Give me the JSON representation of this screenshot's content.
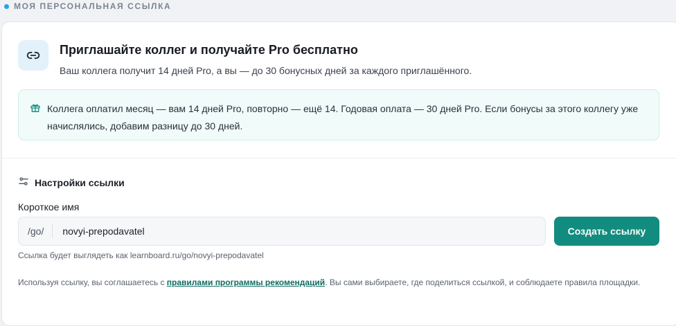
{
  "section": {
    "title": "МОЯ ПЕРСОНАЛЬНАЯ ССЫЛКА"
  },
  "hero": {
    "icon": "link-icon",
    "title": "Приглашайте коллег и получайте Pro бесплатно",
    "subtitle": "Ваш коллега получит 14 дней Pro, а вы — до 30 бонусных дней за каждого приглашённого."
  },
  "notice": {
    "icon": "gift-icon",
    "text": "Коллега оплатил месяц — вам 14 дней Pro, повторно — ещё 14. Годовая оплата — 30 дней Pro. Если бонусы за этого коллегу уже начислялись, добавим разницу до 30 дней."
  },
  "settings": {
    "icon": "sliders-icon",
    "title": "Настройки ссылки",
    "field_label": "Короткое имя",
    "prefix": "/go/",
    "value": "novyi-prepodavatel",
    "button_label": "Создать ссылку",
    "preview": "Ссылка будет выглядеть как learnboard.ru/go/novyi-prepodavatel"
  },
  "legal": {
    "before": "Используя ссылку, вы соглашаетесь с ",
    "link": "правилами программы рекомендаций",
    "after": ". Вы сами выбираете, где поделиться ссылкой, и соблюдаете правила площадки."
  },
  "colors": {
    "accent": "#128c7e",
    "dot": "#2aa1ea",
    "icon_bg": "#e3f1fb",
    "notice_bg": "#f0fbfa"
  }
}
